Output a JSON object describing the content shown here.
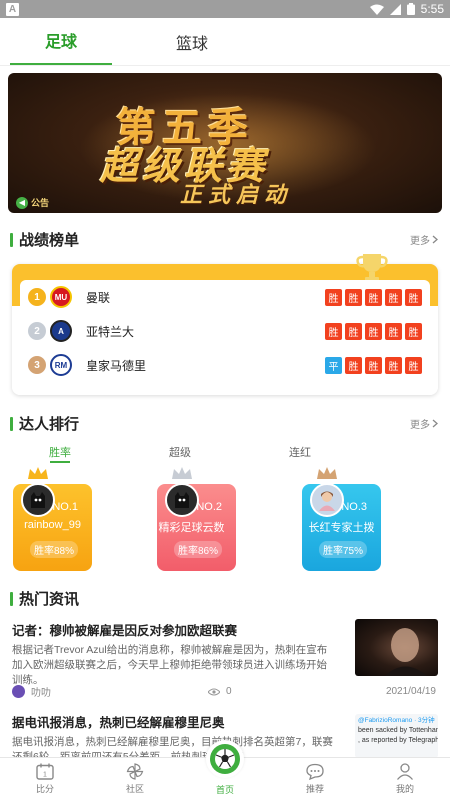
{
  "status_bar": {
    "app_icon": "A",
    "time": "5:55"
  },
  "top_tabs": [
    {
      "label": "足球",
      "active": true
    },
    {
      "label": "篮球",
      "active": false
    }
  ],
  "banner": {
    "line1": "第五季",
    "line2": "超级联赛",
    "line3": "正式启动",
    "notice": "公告"
  },
  "standings": {
    "title": "战绩榜单",
    "more": "更多",
    "teams": [
      {
        "rank": "1",
        "name": "曼联",
        "results": [
          "胜",
          "胜",
          "胜",
          "胜",
          "胜"
        ]
      },
      {
        "rank": "2",
        "name": "亚特兰大",
        "results": [
          "胜",
          "胜",
          "胜",
          "胜",
          "胜"
        ]
      },
      {
        "rank": "3",
        "name": "皇家马德里",
        "results": [
          "平",
          "胜",
          "胜",
          "胜",
          "胜"
        ]
      }
    ]
  },
  "experts": {
    "title": "达人排行",
    "more": "更多",
    "tabs": [
      "胜率",
      "超级",
      "连红"
    ],
    "cards": [
      {
        "no": "NO.1",
        "name": "rainbow_99",
        "rate": "胜率88%"
      },
      {
        "no": "NO.2",
        "name": "精彩足球云数",
        "rate": "胜率86%"
      },
      {
        "no": "NO.3",
        "name": "长红专家土拨",
        "rate": "胜率75%"
      }
    ]
  },
  "news": {
    "title": "热门资讯",
    "items": [
      {
        "title": "记者：穆帅被解雇是因反对参加欧超联赛",
        "body": "根据记者Trevor Azul给出的消息称，穆帅被解雇是因为，热刺在宣布加入欧洲超级联赛之后，今天早上穆帅拒绝带领球员进入训练场开始训练。",
        "author": "叻叻",
        "views": "0",
        "date": "2021/04/19"
      },
      {
        "title": "据电讯报消息，热刺已经解雇穆里尼奥",
        "body": "据电讯报消息，热刺已经解雇穆里尼奥，目前热刺排名英超第7，联赛还剩6轮，距离前四还有5分差距。前热刺球员梅森",
        "thumb_handle": "@FabrizioRomano · 3分钟",
        "thumb_text1": "been sacked by Tottenham, to",
        "thumb_text2": ", as reported by Telegraph."
      }
    ]
  },
  "bottom_nav": [
    {
      "label": "比分",
      "icon": "calendar-icon"
    },
    {
      "label": "社区",
      "icon": "pinwheel-icon"
    },
    {
      "label": "首页",
      "icon": "soccer-ball-icon"
    },
    {
      "label": "推荐",
      "icon": "chat-bubble-icon"
    },
    {
      "label": "我的",
      "icon": "person-icon"
    }
  ],
  "colors": {
    "accent": "#3fae3f",
    "win": "#f2411f",
    "draw": "#2aa8e8",
    "gold": "#fbc02d"
  }
}
